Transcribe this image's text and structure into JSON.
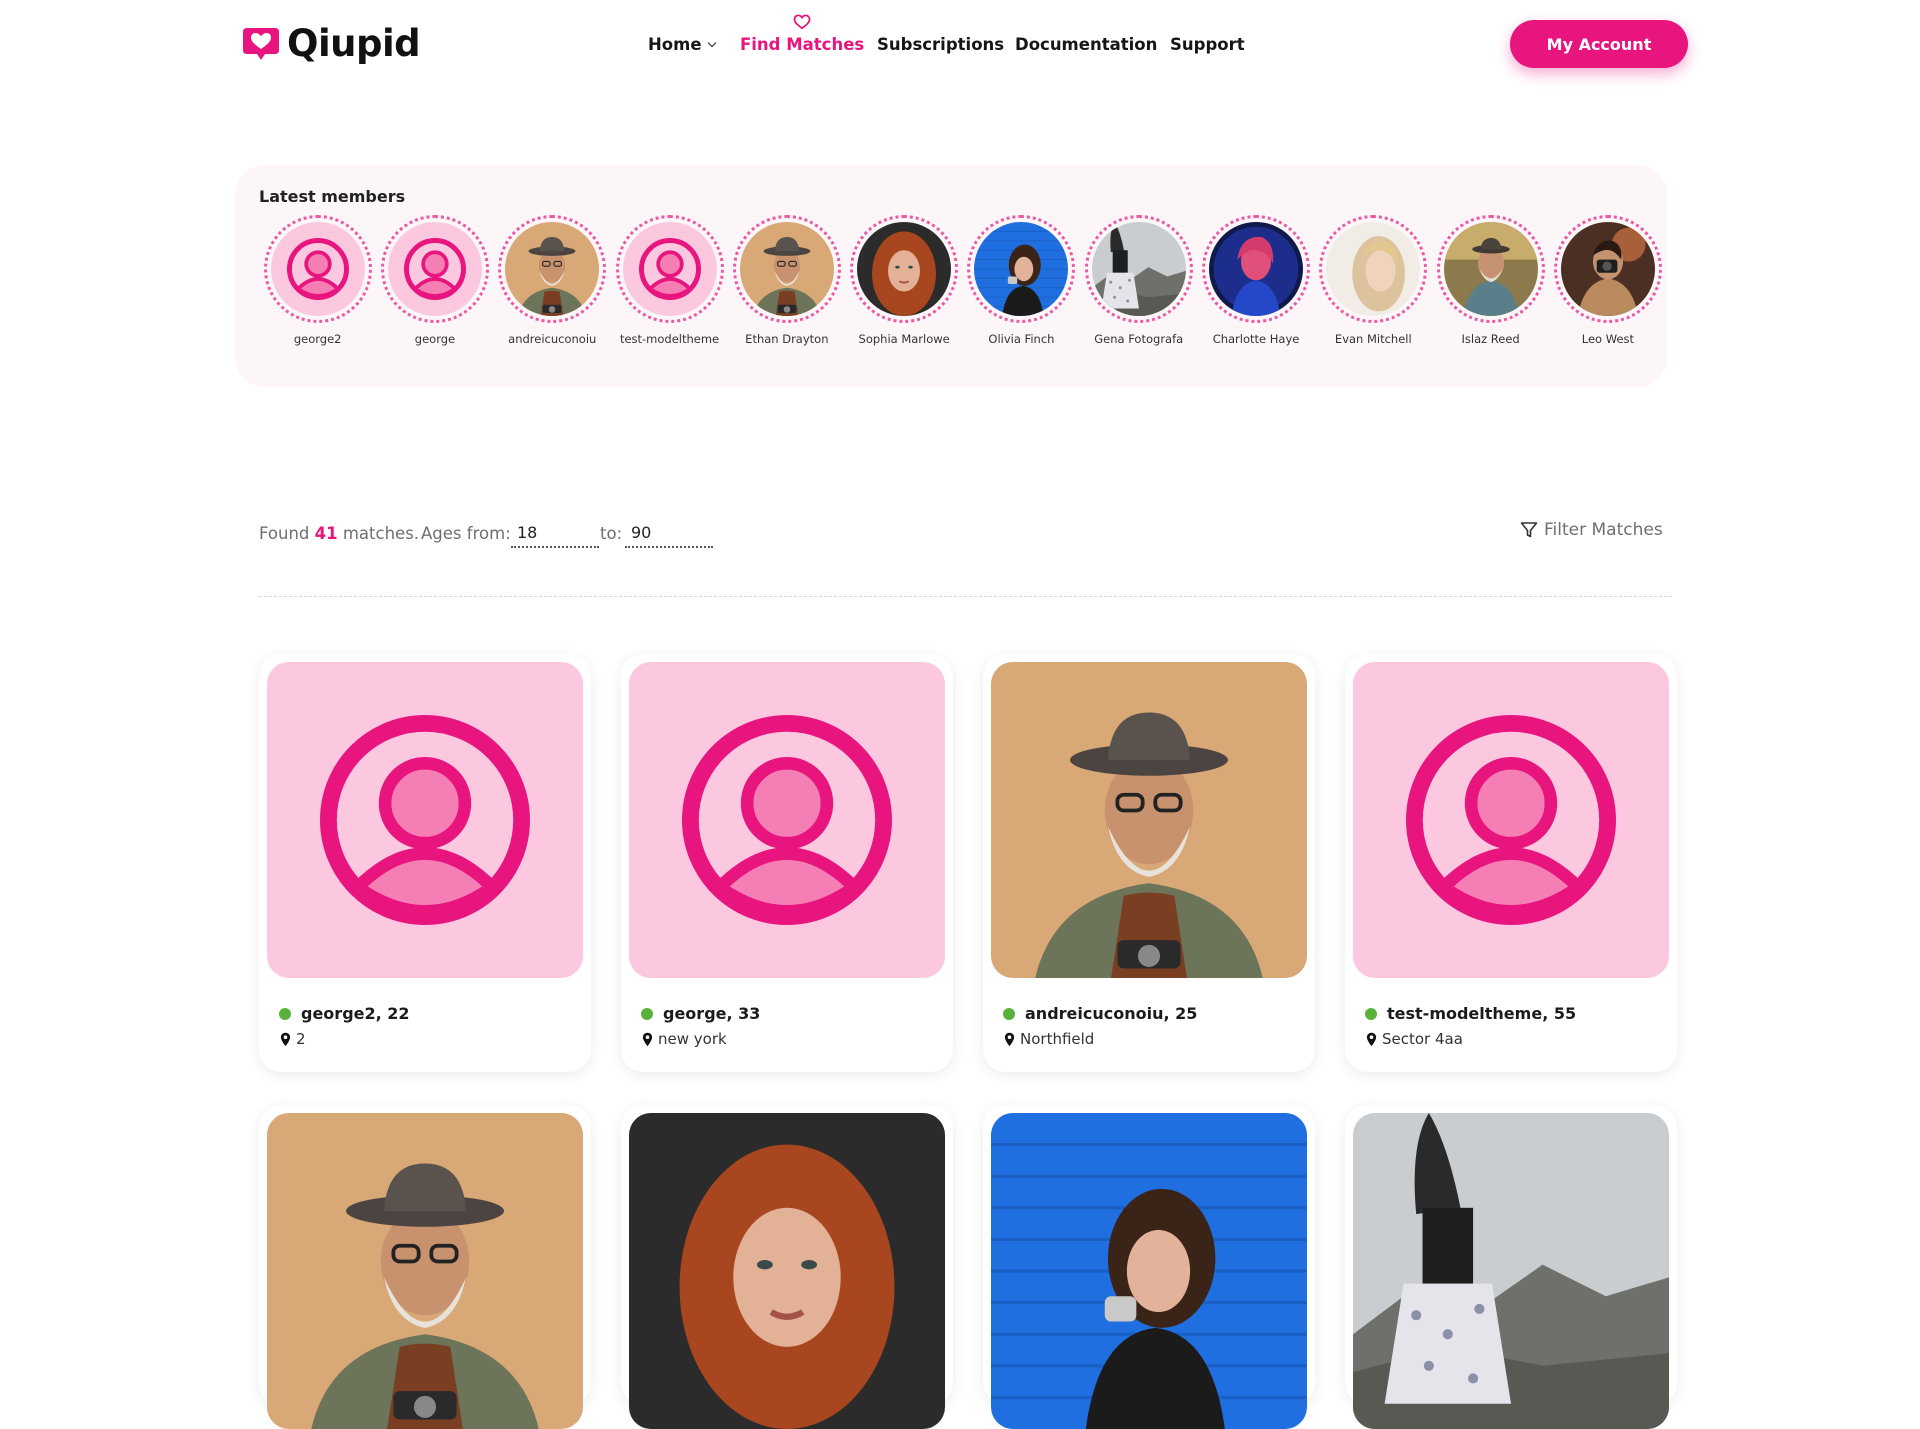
{
  "brand": {
    "name": "Qiupid",
    "accent": "#e8157f"
  },
  "nav": {
    "items": [
      {
        "label": "Home"
      },
      {
        "label": "Find Matches"
      },
      {
        "label": "Subscriptions"
      },
      {
        "label": "Documentation"
      },
      {
        "label": "Support"
      }
    ],
    "active": "Find Matches"
  },
  "account_button": "My Account",
  "latest": {
    "title": "Latest members",
    "members": [
      {
        "name": "george2",
        "avatar": "placeholder"
      },
      {
        "name": "george",
        "avatar": "placeholder"
      },
      {
        "name": "andreicuconoiu",
        "avatar": "man-hat-photo"
      },
      {
        "name": "test-modeltheme",
        "avatar": "placeholder"
      },
      {
        "name": "Ethan Drayton",
        "avatar": "man-hat-photo"
      },
      {
        "name": "Sophia Marlowe",
        "avatar": "redhead-photo"
      },
      {
        "name": "Olivia Finch",
        "avatar": "woman-blue-photo"
      },
      {
        "name": "Gena Fotografa",
        "avatar": "woman-landscape-photo"
      },
      {
        "name": "Charlotte Haye",
        "avatar": "neon-portrait-photo"
      },
      {
        "name": "Evan Mitchell",
        "avatar": "blonde-portrait-photo"
      },
      {
        "name": "Islaz Reed",
        "avatar": "man-outdoor-photo"
      },
      {
        "name": "Leo West",
        "avatar": "photographer-photo"
      }
    ]
  },
  "results": {
    "found_prefix": "Found",
    "count": "41",
    "found_suffix": "matches.",
    "ages_label": "Ages from:",
    "age_from": "18",
    "to_label": "to:",
    "age_to": "90",
    "filter_label": "Filter Matches"
  },
  "cards": [
    {
      "name": "george2",
      "age": "22",
      "location": "2",
      "online": true,
      "image": "placeholder"
    },
    {
      "name": "george",
      "age": "33",
      "location": "new york",
      "online": true,
      "image": "placeholder"
    },
    {
      "name": "andreicuconoiu",
      "age": "25",
      "location": "Northfield",
      "online": true,
      "image": "man-hat-photo"
    },
    {
      "name": "test-modeltheme",
      "age": "55",
      "location": "Sector 4aa",
      "online": true,
      "image": "placeholder"
    },
    {
      "image": "man-hat-photo"
    },
    {
      "image": "redhead-photo"
    },
    {
      "image": "woman-blue-photo"
    },
    {
      "image": "woman-landscape-photo"
    }
  ],
  "colors": {
    "accent": "#e8157f",
    "placeholder_bg": "#fbc8e0",
    "online": "#58b13b",
    "latest_bg": "#fcf6f9"
  }
}
